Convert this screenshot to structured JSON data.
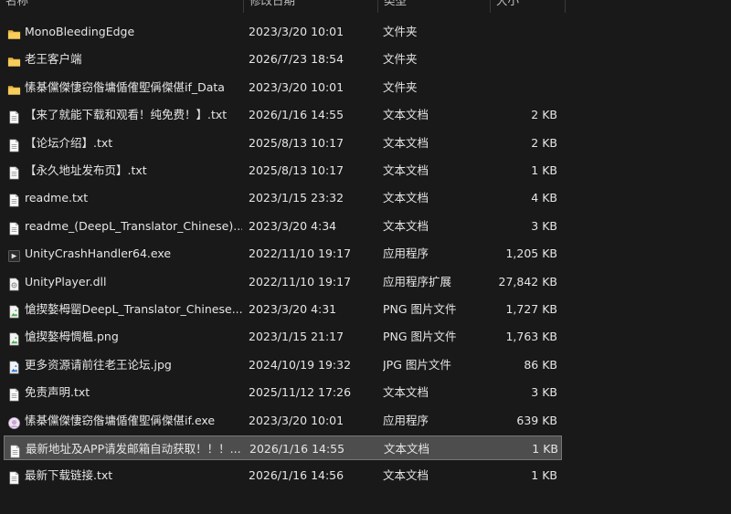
{
  "columns": {
    "name": "名称",
    "date": "修改日期",
    "type": "类型",
    "size": "大小"
  },
  "colors": {
    "folder": "#f2c14e",
    "document": "#ffffff",
    "selected_row": "#4d4d4d"
  },
  "files": [
    {
      "name": "MonoBleedingEdge",
      "date": "2023/3/20 10:01",
      "type": "文件夹",
      "size": "",
      "icon": "folder-icon"
    },
    {
      "name": "老王客户端",
      "date": "2026/7/23 18:54",
      "type": "文件夹",
      "size": "",
      "icon": "folder-icon"
    },
    {
      "name": "愫棊儻傑悽窃偺墉偱傕堲偁傑偡if_Data",
      "date": "2023/3/20 10:01",
      "type": "文件夹",
      "size": "",
      "icon": "folder-icon"
    },
    {
      "name": "【来了就能下载和观看！纯免费！】.txt",
      "date": "2026/1/16 14:55",
      "type": "文本文档",
      "size": "2 KB",
      "icon": "text-file-icon"
    },
    {
      "name": "【论坛介绍】.txt",
      "date": "2025/8/13 10:17",
      "type": "文本文档",
      "size": "2 KB",
      "icon": "text-file-icon"
    },
    {
      "name": "【永久地址发布页】.txt",
      "date": "2025/8/13 10:17",
      "type": "文本文档",
      "size": "1 KB",
      "icon": "text-file-icon"
    },
    {
      "name": "readme.txt",
      "date": "2023/1/15 23:32",
      "type": "文本文档",
      "size": "4 KB",
      "icon": "text-file-icon"
    },
    {
      "name": "readme_(DeepL_Translator_Chinese)....",
      "date": "2023/3/20 4:34",
      "type": "文本文档",
      "size": "3 KB",
      "icon": "text-file-icon"
    },
    {
      "name": "UnityCrashHandler64.exe",
      "date": "2022/11/10 19:17",
      "type": "应用程序",
      "size": "1,205 KB",
      "icon": "unity-exe-icon"
    },
    {
      "name": "UnityPlayer.dll",
      "date": "2022/11/10 19:17",
      "type": "应用程序扩展",
      "size": "27,842 KB",
      "icon": "dll-file-icon"
    },
    {
      "name": "愴揳嫯栂罂DeepL_Translator_Chinese...",
      "date": "2023/3/20 4:31",
      "type": "PNG 图片文件",
      "size": "1,727 KB",
      "icon": "png-image-icon"
    },
    {
      "name": "愴揳嫯栂惆榅.png",
      "date": "2023/1/15 21:17",
      "type": "PNG 图片文件",
      "size": "1,763 KB",
      "icon": "png-image-icon"
    },
    {
      "name": "更多资源请前往老王论坛.jpg",
      "date": "2024/10/19 19:32",
      "type": "JPG 图片文件",
      "size": "86 KB",
      "icon": "jpg-image-icon"
    },
    {
      "name": "免责声明.txt",
      "date": "2025/11/12 17:26",
      "type": "文本文档",
      "size": "3 KB",
      "icon": "text-file-icon"
    },
    {
      "name": "愫棊儻傑悽窃偺墉偱傕堲偁傑偡if.exe",
      "date": "2023/3/20 10:01",
      "type": "应用程序",
      "size": "639 KB",
      "icon": "app-exe-icon"
    },
    {
      "name": "最新地址及APP请发邮箱自动获取！！！...",
      "date": "2026/1/16 14:55",
      "type": "文本文档",
      "size": "1 KB",
      "icon": "text-file-icon",
      "selected": true
    },
    {
      "name": "最新下载链接.txt",
      "date": "2026/1/16 14:56",
      "type": "文本文档",
      "size": "1 KB",
      "icon": "text-file-icon"
    }
  ]
}
